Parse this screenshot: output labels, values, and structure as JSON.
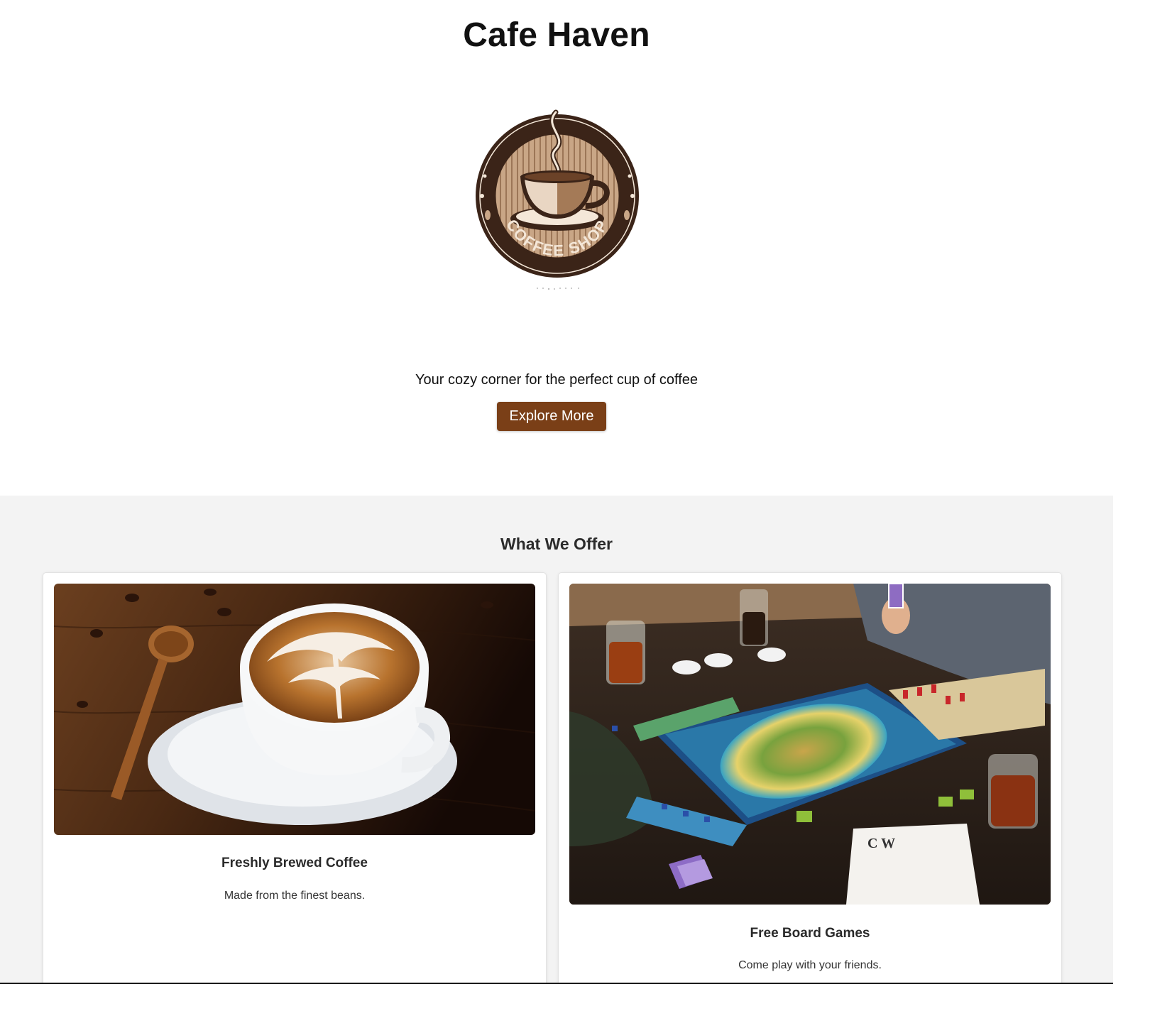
{
  "hero": {
    "title": "Cafe Haven",
    "logo_text": "COFFEE SHOP",
    "tagline": "Your cozy corner for the perfect cup of coffee",
    "cta_label": "Explore More"
  },
  "offer": {
    "title": "What We Offer",
    "cards": [
      {
        "title": "Freshly Brewed Coffee",
        "description": "Made from the finest beans.",
        "image": "latte-art-cup-photo"
      },
      {
        "title": "Free Board Games",
        "description": "Come play with your friends.",
        "image": "board-game-table-photo"
      }
    ]
  },
  "colors": {
    "accent": "#7a3f17",
    "section_bg": "#f3f3f3",
    "logo_dark": "#3b2418"
  }
}
